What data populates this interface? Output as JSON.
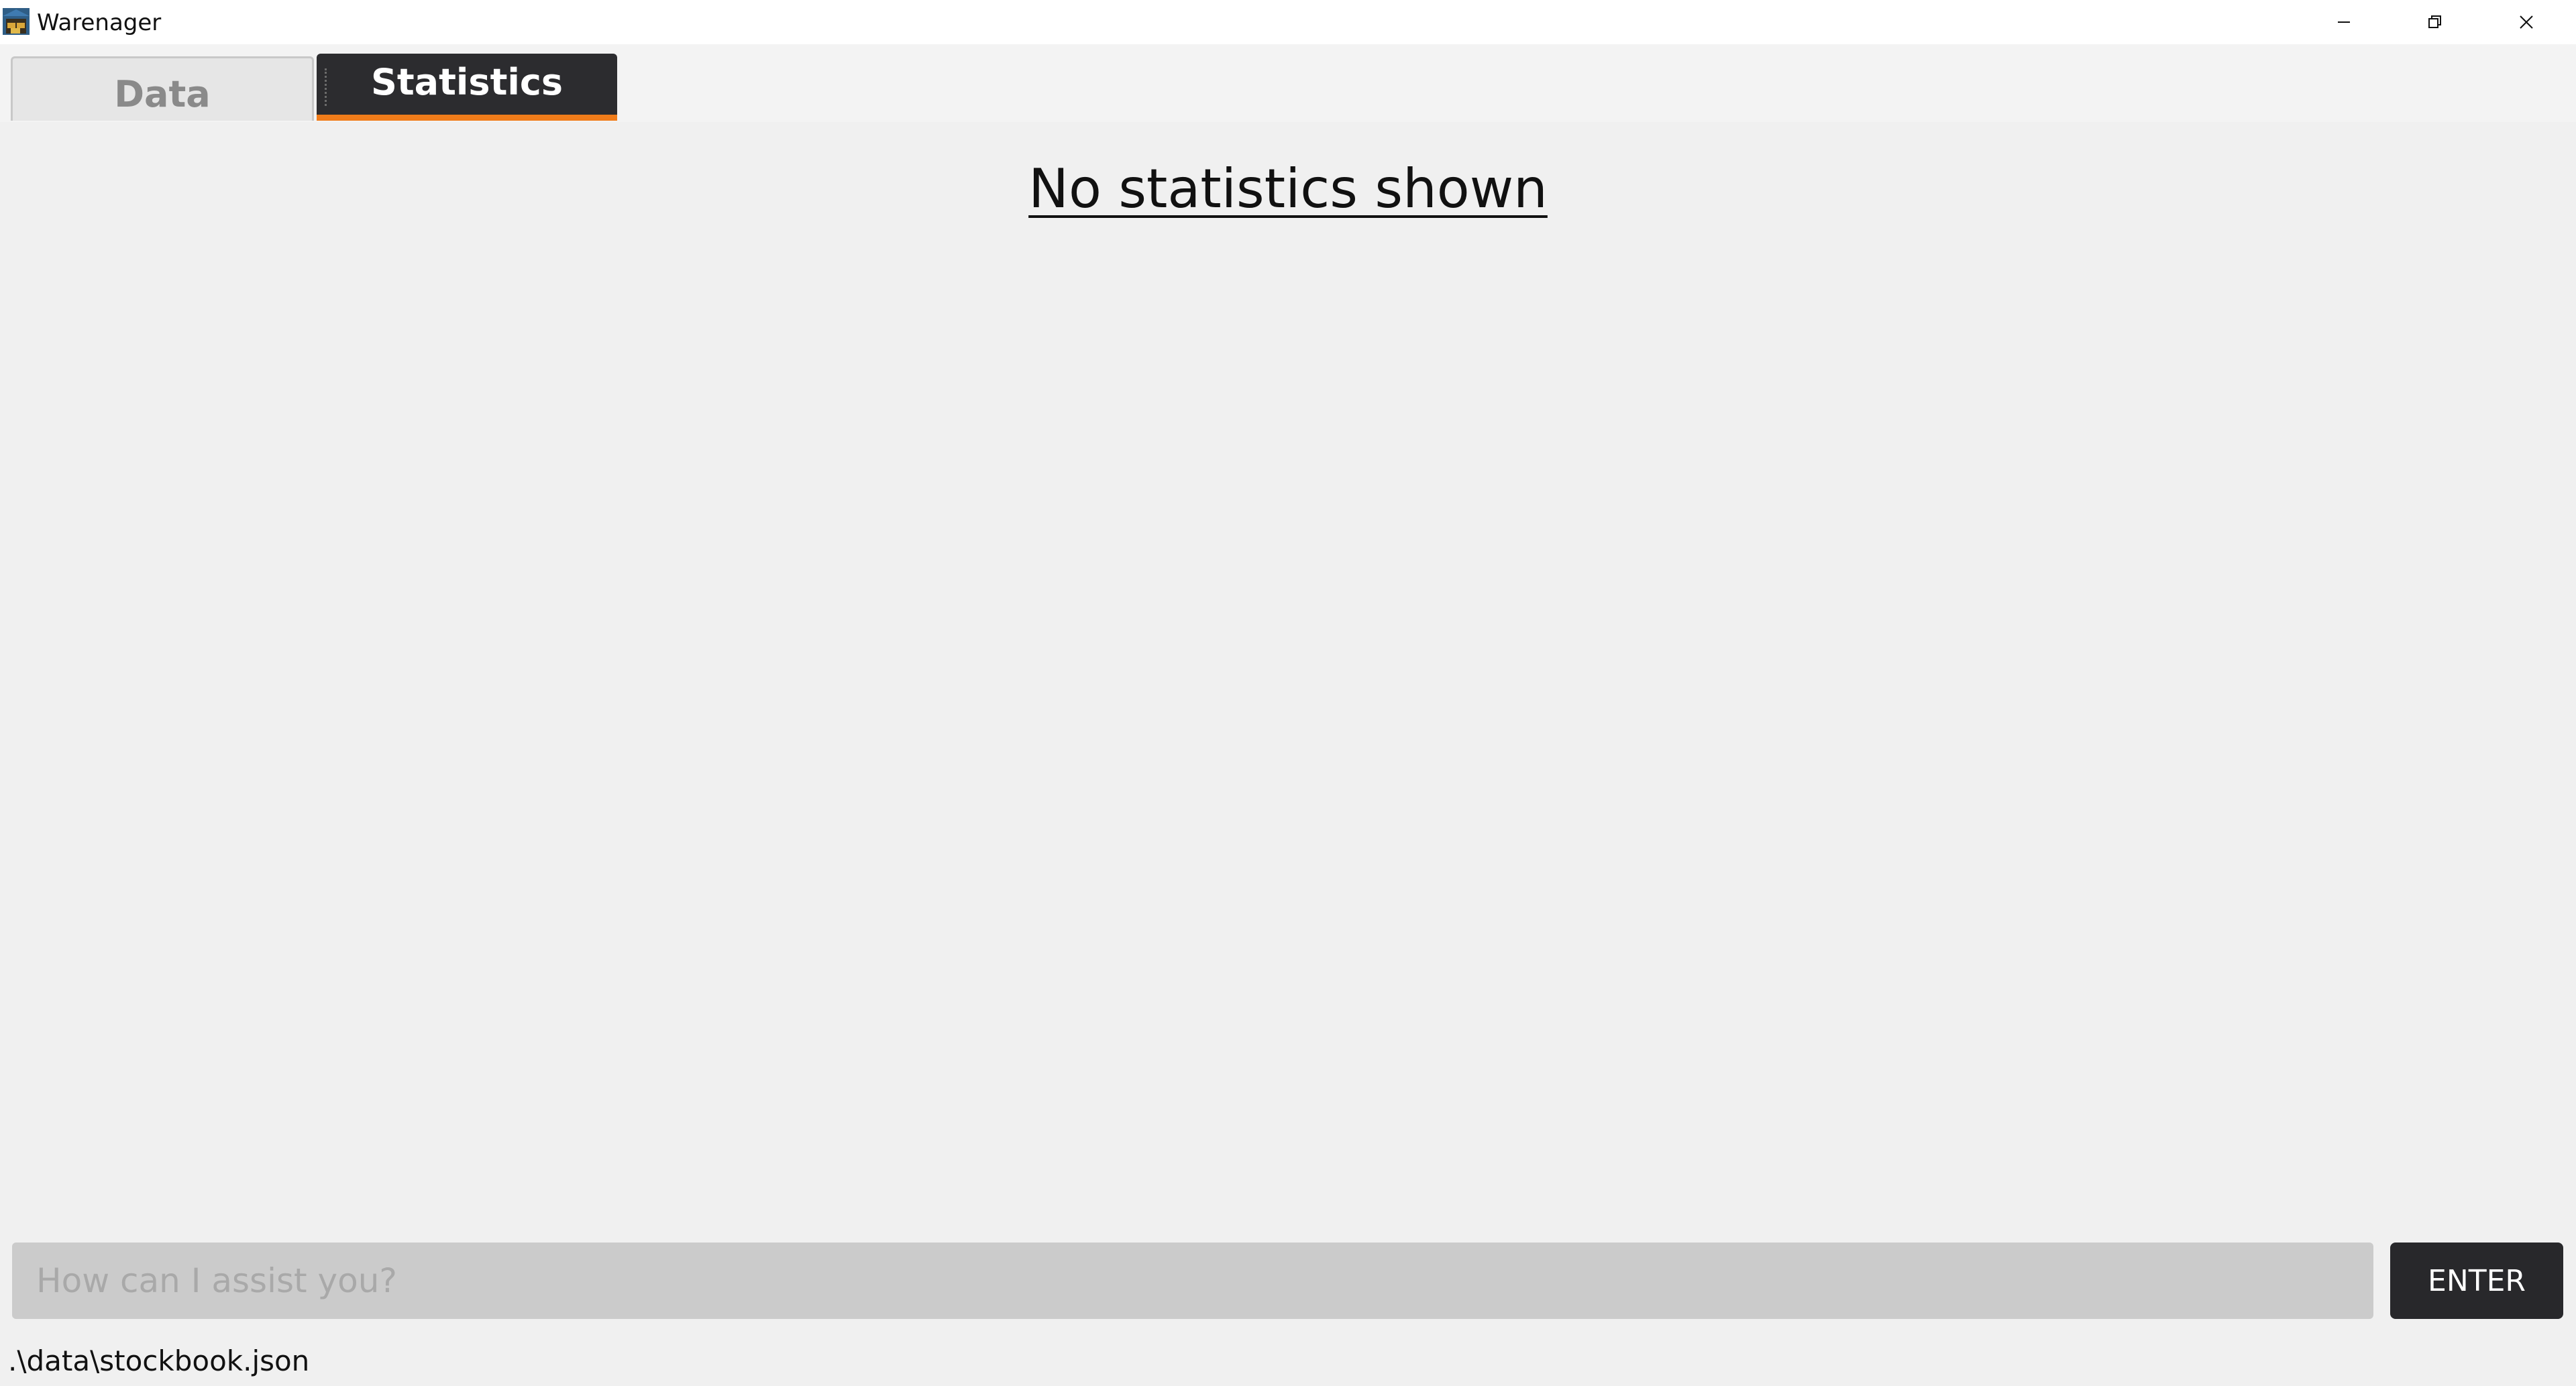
{
  "window": {
    "title": "Warenager",
    "controls": {
      "minimize": "minimize-icon",
      "maximize": "restore-icon",
      "close": "close-icon"
    }
  },
  "tabs": [
    {
      "label": "Data",
      "selected": false
    },
    {
      "label": "Statistics",
      "selected": true
    }
  ],
  "main": {
    "empty_message": "No statistics shown"
  },
  "command": {
    "placeholder": "How can I assist you?",
    "value": "",
    "enter_label": "ENTER"
  },
  "status": {
    "file_path": ".\\data\\stockbook.json"
  },
  "colors": {
    "accent": "#f07c1a",
    "selected_tab_bg": "#2c2c2f",
    "button_bg": "#28282b"
  }
}
